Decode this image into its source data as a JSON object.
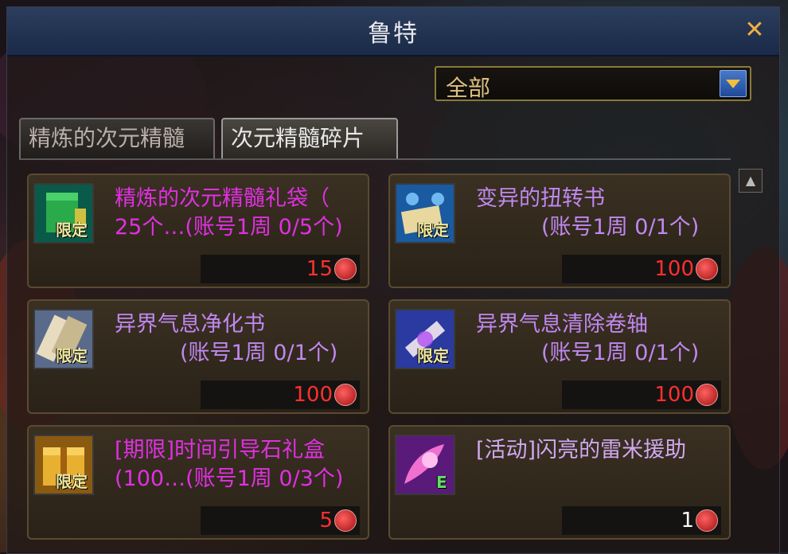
{
  "window": {
    "title": "鲁特",
    "close_label": "✕"
  },
  "filter": {
    "selected": "全部"
  },
  "tabs": [
    {
      "label": "精炼的次元精髓"
    },
    {
      "label": "次元精髓碎片"
    }
  ],
  "items": [
    {
      "name": "精炼的次元精髓礼袋（",
      "sub": "25个…(账号1周 0/5个)",
      "price": "15",
      "badge": "限定",
      "name_color": "#e030e0"
    },
    {
      "name": "变异的扭转书",
      "sub": "(账号1周 0/1个)",
      "price": "100",
      "badge": "限定",
      "name_color": "#c088f0"
    },
    {
      "name": "异界气息净化书",
      "sub": "(账号1周 0/1个)",
      "price": "100",
      "badge": "限定",
      "name_color": "#c088f0"
    },
    {
      "name": "异界气息清除卷轴",
      "sub": "(账号1周 0/1个)",
      "price": "100",
      "badge": "限定",
      "name_color": "#c088f0"
    },
    {
      "name": "[期限]时间引导石礼盒",
      "sub": "(100…(账号1周 0/3个)",
      "price": "5",
      "badge": "限定",
      "name_color": "#e030e0"
    },
    {
      "name": "[活动]闪亮的雷米援助",
      "sub": "",
      "price": "1",
      "badge": "E",
      "name_color": "#d0a8f0"
    }
  ],
  "icons": [
    "green-bag-icon",
    "spellbook-icon",
    "scroll-icon",
    "purple-scroll-icon",
    "gift-box-icon",
    "pink-aid-icon",
    "currency-coin-icon"
  ]
}
